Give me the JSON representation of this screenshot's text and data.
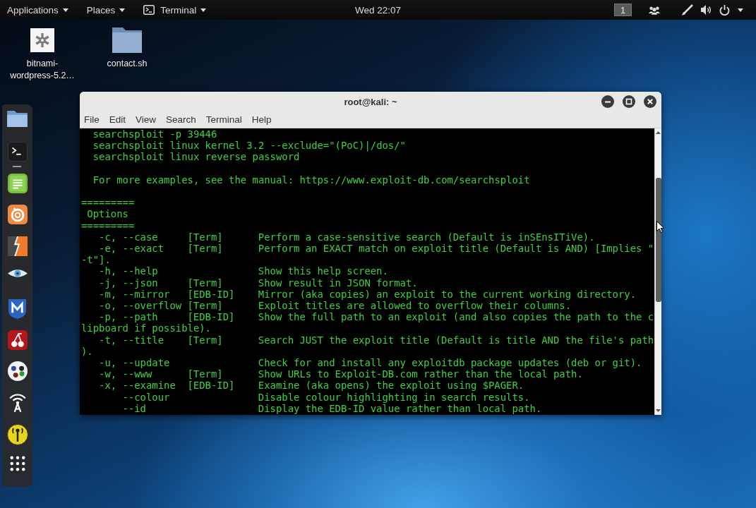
{
  "top_bar": {
    "menus": [
      {
        "label": "Applications",
        "kind": "menu"
      },
      {
        "label": "Places",
        "kind": "menu"
      },
      {
        "label": "Terminal",
        "kind": "app"
      }
    ],
    "clock": "Wed 22:07",
    "workspace": "1"
  },
  "desktop_icons": [
    {
      "label": "bitnami-wordpress-5.2…",
      "kind": "package"
    },
    {
      "label": "contact.sh",
      "kind": "folder"
    }
  ],
  "dock": [
    {
      "running": false
    },
    {
      "running": true
    },
    {
      "running": false
    },
    {
      "running": false
    },
    {
      "running": false
    },
    {
      "running": false
    },
    {
      "running": false
    },
    {
      "running": false
    },
    {
      "running": false
    },
    {
      "running": false
    },
    {
      "running": false
    },
    {
      "running": false
    }
  ],
  "window": {
    "title": "root@kali: ~",
    "menu": [
      "File",
      "Edit",
      "View",
      "Search",
      "Terminal",
      "Help"
    ],
    "terminal": {
      "blocks": [
        {
          "kind": "text",
          "lines": [
            "searchsploit -p 39446",
            "searchsploit linux kernel 3.2 --exclude=\"(PoC)|/dos/\"",
            "searchsploit linux reverse password"
          ]
        },
        {
          "kind": "text",
          "lines": [
            "For more examples, see the manual: https://www.exploit-db.com/searchsploit"
          ]
        },
        {
          "kind": "section",
          "rule_above": "=========",
          "title": "Options",
          "rule_below": "=========",
          "options": [
            {
              "short": "-c,",
              "long": "--case",
              "argument": "[Term]",
              "description": "Perform a case-sensitive search (Default is inSEnsITiVe)."
            },
            {
              "short": "-e,",
              "long": "--exact",
              "argument": "[Term]",
              "description": "Perform an EXACT match on exploit title (Default is AND) [Implies \"",
              "wrapped": "-t\"]."
            },
            {
              "short": "-h,",
              "long": "--help",
              "description": "Show this help screen."
            },
            {
              "short": "-j,",
              "long": "--json",
              "argument": "[Term]",
              "description": "Show result in JSON format."
            },
            {
              "short": "-m,",
              "long": "--mirror",
              "argument": "[EDB-ID]",
              "description": "Mirror (aka copies) an exploit to the current working directory."
            },
            {
              "short": "-o,",
              "long": "--overflow",
              "argument": "[Term]",
              "description": "Exploit titles are allowed to overflow their columns."
            },
            {
              "short": "-p,",
              "long": "--path",
              "argument": "[EDB-ID]",
              "description": "Show the full path to an exploit (and also copies the path to the c",
              "wrapped": "lipboard if possible)."
            },
            {
              "short": "-t,",
              "long": "--title",
              "argument": "[Term]",
              "description": "Search JUST the exploit title (Default is title AND the file's path",
              "wrapped": ")."
            },
            {
              "short": "-u,",
              "long": "--update",
              "description": "Check for and install any exploitdb package updates (deb or git)."
            },
            {
              "short": "-w,",
              "long": "--www",
              "argument": "[Term]",
              "description": "Show URLs to Exploit-DB.com rather than the local path."
            },
            {
              "short": "-x,",
              "long": "--examine",
              "argument": "[EDB-ID]",
              "description": "Examine (aka opens) the exploit using $PAGER."
            },
            {
              "long": "--colour",
              "description": "Disable colour highlighting in search results."
            },
            {
              "long": "--id",
              "description": "Display the EDB-ID value rather than local path."
            }
          ]
        }
      ]
    }
  }
}
